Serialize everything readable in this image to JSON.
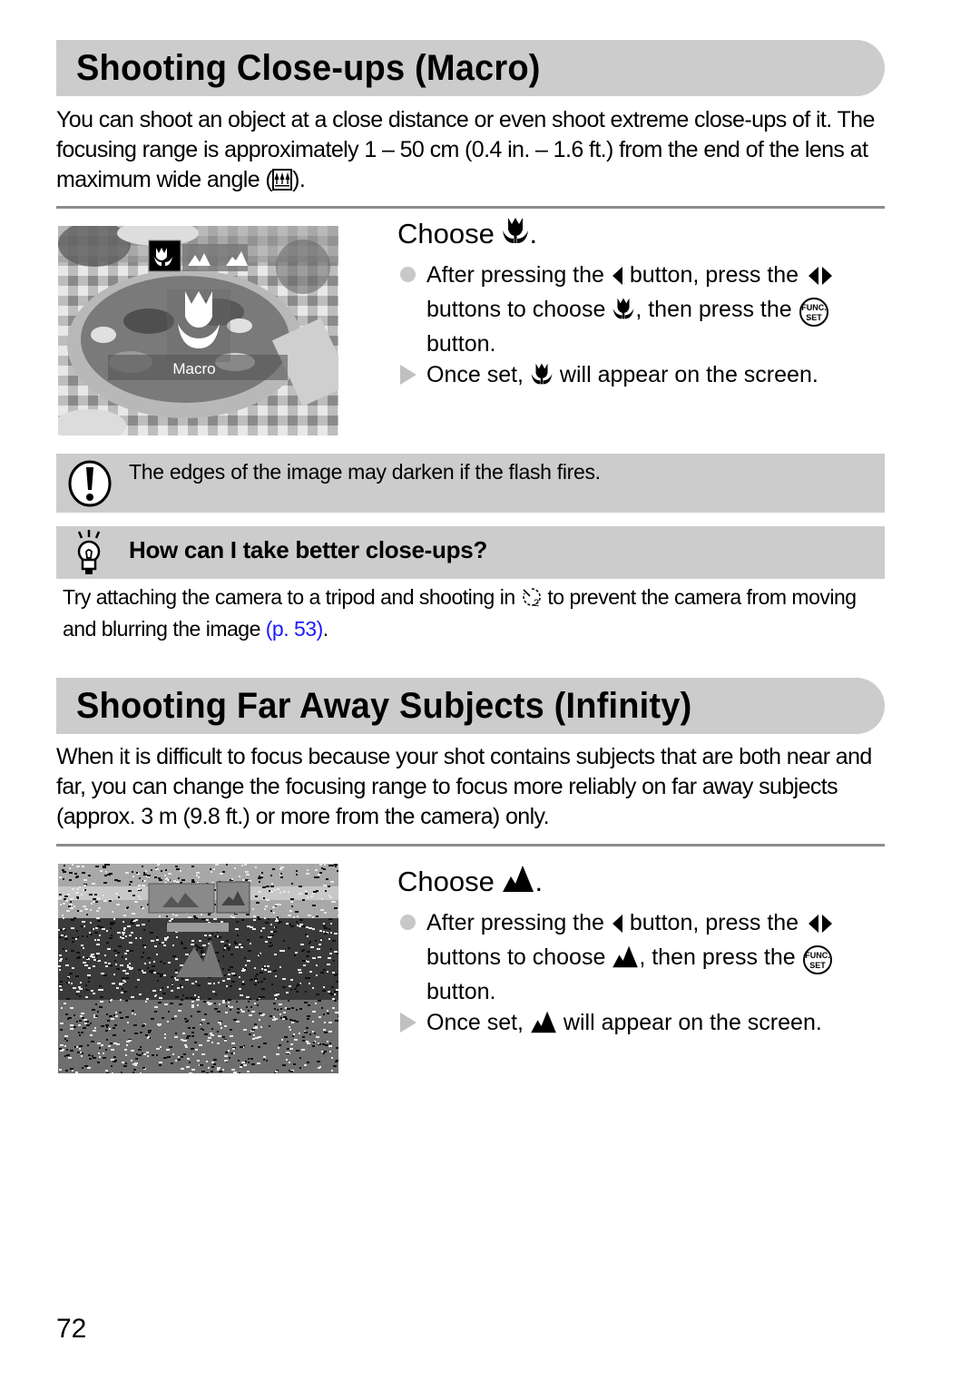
{
  "page": {
    "number": "72",
    "link_color": "#1a1aff",
    "header_bg": "#cccccc"
  },
  "macro": {
    "title": "Shooting Close-ups (Macro)",
    "intro_before_icon": "You can shoot an object at a close distance or even shoot extreme close-ups of it. The focusing range is approximately 1 – 50 cm (0.4 in. – 1.6 ft.) from the end of the lens at maximum wide angle (",
    "intro_icon": "wide-angle-trees-icon",
    "intro_after_icon": ").",
    "photo": {
      "description": "Camera LCD showing pizza with focus mode menu",
      "menu_icons": [
        "macro-icon",
        "normal-af-icon",
        "infinity-icon"
      ],
      "selected": "macro-icon",
      "label": "Macro"
    },
    "step": {
      "title": "Choose",
      "title_icon": "macro-tulip-icon",
      "title_suffix": ".",
      "bullet1": {
        "part1": "After pressing the",
        "icon1": "left-arrow-button-icon",
        "part2": "button, press the",
        "icon2": "left-right-arrow-buttons-icon",
        "part3": "buttons to choose",
        "icon3": "macro-tulip-icon",
        "part4": ", then press the",
        "icon4": "func-set-button-icon",
        "func_top": "FUNC.",
        "func_bottom": "SET",
        "part5": "button."
      },
      "result": {
        "part1": "Once set,",
        "icon": "macro-tulip-icon",
        "part2": "will appear on the screen."
      }
    }
  },
  "caution": {
    "icon": "caution-exclamation-icon",
    "text": "The edges of the image may darken if the flash fires."
  },
  "tip": {
    "icon": "lightbulb-tip-icon",
    "title": "How can I take better close-ups?",
    "text_before_icon": "Try attaching the camera to a tripod and shooting in",
    "text_icon": "self-timer-2sec-icon",
    "text_after_icon": "to prevent the camera from moving and blurring the image",
    "link": "(p. 53)",
    "text_end": "."
  },
  "infinity": {
    "title": "Shooting Far Away Subjects (Infinity)",
    "intro": "When it is difficult to focus because your shot contains subjects that are both near and far, you can change the focusing range to focus more reliably on far away subjects (approx. 3 m (9.8 ft.) or more from the camera) only.",
    "photo": {
      "description": "Camera LCD showing landscape with infinity focus icon",
      "menu_icons": [
        "normal-af-icon",
        "infinity-icon"
      ],
      "selected": "infinity-icon"
    },
    "step": {
      "title": "Choose",
      "title_icon": "infinity-mountain-icon",
      "title_suffix": ".",
      "bullet1": {
        "part1": "After pressing the",
        "icon1": "left-arrow-button-icon",
        "part2": "button, press the",
        "icon2": "left-right-arrow-buttons-icon",
        "part3": "buttons to choose",
        "icon3": "infinity-mountain-icon",
        "part4": ", then press the",
        "icon4": "func-set-button-icon",
        "func_top": "FUNC.",
        "func_bottom": "SET",
        "part5": "button."
      },
      "result": {
        "part1": "Once set,",
        "icon": "infinity-mountain-icon",
        "part2": "will appear on the screen."
      }
    }
  }
}
